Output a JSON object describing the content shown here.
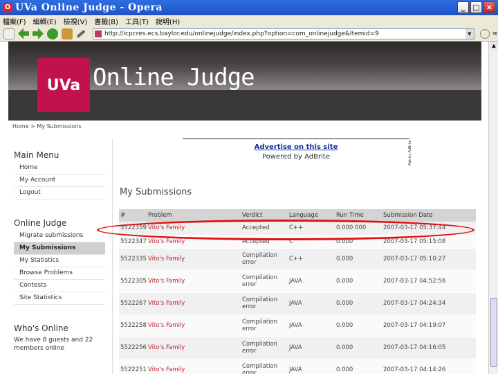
{
  "window": {
    "title": "UVa Online Judge - Opera",
    "buttons": [
      "_",
      "□",
      "×"
    ]
  },
  "menubar": {
    "items": [
      "檔案(F)",
      "編輯(E)",
      "檢視(V)",
      "書籤(B)",
      "工具(T)",
      "說明(H)"
    ]
  },
  "toolbar": {
    "address": "http://icpcres.ecs.baylor.edu/onlinejudge/index.php?option=com_onlinejudge&Itemid=9"
  },
  "header": {
    "logo": "UVa",
    "title": "Online Judge"
  },
  "breadcrumb": "Home > My Submissions",
  "ad": {
    "link": "Advertise on this site",
    "by": "Powered by AdBrite",
    "side": "Ads by AdBrite"
  },
  "sidebar": {
    "main_menu_title": "Main Menu",
    "main_menu": [
      "Home",
      "My Account",
      "Logout"
    ],
    "judge_title": "Online Judge",
    "judge_menu": [
      "Migrate submissions",
      "My Submissions",
      "My Statistics",
      "Browse Problems",
      "Contests",
      "Site Statistics"
    ],
    "who_title": "Who's Online",
    "who_text": "We have 8 guests and 22 members online"
  },
  "main": {
    "page_title": "My Submissions",
    "columns": [
      "#",
      "Problem",
      "Verdict",
      "Language",
      "Run Time",
      "Submission Date"
    ],
    "rows": [
      {
        "id": "5522359",
        "problem": "Vito's Family",
        "verdict": "Accepted",
        "language": "C++",
        "run_time": "0.000 000",
        "date": "2007-03-17 05:37:44"
      },
      {
        "id": "5522347",
        "problem": "Vito's Family",
        "verdict": "Accepted",
        "language": "C",
        "run_time": "0.000",
        "date": "2007-03-17 05:15:08"
      },
      {
        "id": "5522335",
        "problem": "Vito's Family",
        "verdict": "Compilation error",
        "language": "C++",
        "run_time": "0.000",
        "date": "2007-03-17 05:10:27"
      },
      {
        "id": "5522305",
        "problem": "Vito's Family",
        "verdict": "Compilation error",
        "language": "JAVA",
        "run_time": "0.000",
        "date": "2007-03-17 04:52:56"
      },
      {
        "id": "5522267",
        "problem": "Vito's Family",
        "verdict": "Compilation error",
        "language": "JAVA",
        "run_time": "0.000",
        "date": "2007-03-17 04:24:34"
      },
      {
        "id": "5522258",
        "problem": "Vito's Family",
        "verdict": "Compilation error",
        "language": "JAVA",
        "run_time": "0.000",
        "date": "2007-03-17 04:19:07"
      },
      {
        "id": "5522256",
        "problem": "Vito's Family",
        "verdict": "Compilation error",
        "language": "JAVA",
        "run_time": "0.000",
        "date": "2007-03-17 04:16:05"
      },
      {
        "id": "5522251",
        "problem": "Vito's Family",
        "verdict": "Compilation error",
        "language": "JAVA",
        "run_time": "0.000",
        "date": "2007-03-17 04:14:26"
      }
    ]
  },
  "colors": {
    "brand": "#c2124b",
    "title_bar": "#1d52c8",
    "link": "#b8262f",
    "highlight": "#e01010"
  }
}
